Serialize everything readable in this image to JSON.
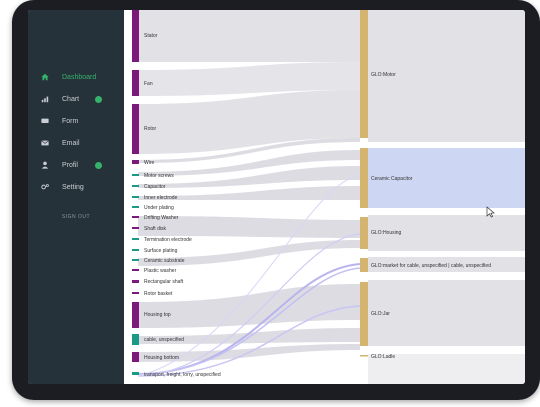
{
  "sidebar": {
    "items": [
      {
        "label": "Dashboard",
        "icon": "home-icon",
        "active": true
      },
      {
        "label": "Chart",
        "icon": "bar-chart-icon",
        "badge": true
      },
      {
        "label": "Form",
        "icon": "form-icon"
      },
      {
        "label": "Email",
        "icon": "email-icon"
      },
      {
        "label": "Profil",
        "icon": "user-icon",
        "badge": true
      },
      {
        "label": "Setting",
        "icon": "gear-icon"
      }
    ],
    "signout": "SIGN OUT",
    "accent": "#36b36a"
  },
  "sankey": {
    "left_nodes": [
      {
        "label": "Stator",
        "color": "#7b1a7a"
      },
      {
        "label": "Fan",
        "color": "#7b1a7a"
      },
      {
        "label": "Rotor",
        "color": "#7b1a7a"
      },
      {
        "label": "Wire",
        "color": "#7b1a7a"
      },
      {
        "label": "Motor screws",
        "color": "#1a9a86"
      },
      {
        "label": "Capacitor",
        "color": "#1a9a86"
      },
      {
        "label": "Inner electrode",
        "color": "#1a9a86"
      },
      {
        "label": "Under plating",
        "color": "#1a9a86"
      },
      {
        "label": "Drifting Washer",
        "color": "#7b1a7a"
      },
      {
        "label": "Shaft disk",
        "color": "#7b1a7a"
      },
      {
        "label": "Termination electrode",
        "color": "#1a9a86"
      },
      {
        "label": "Surface plating",
        "color": "#1a9a86"
      },
      {
        "label": "Ceramic substrate",
        "color": "#1a9a86"
      },
      {
        "label": "Plastic washer",
        "color": "#7b1a7a"
      },
      {
        "label": "Rectangular shaft",
        "color": "#7b1a7a"
      },
      {
        "label": "Rotor basket",
        "color": "#7b1a7a"
      },
      {
        "label": "Housing top",
        "color": "#7b1a7a"
      },
      {
        "label": "cable, unspecified",
        "color": "#1a9a86"
      },
      {
        "label": "Housing bottom",
        "color": "#7b1a7a"
      },
      {
        "label": "transport, freight, lorry, unspecified",
        "color": "#1a9a86"
      }
    ],
    "right_nodes": [
      {
        "label": "GLO:Motor",
        "color": "#d4b46e"
      },
      {
        "label": "Ceramic Capacitor",
        "color": "#d4b46e"
      },
      {
        "label": "GLO:Housing",
        "color": "#d4b46e"
      },
      {
        "label": "GLO:market for cable, unspecified | cable, unspecified",
        "color": "#d4b46e"
      },
      {
        "label": "GLO:Jar",
        "color": "#d4b46e"
      },
      {
        "label": "GLO:Ladle",
        "color": "#d4b46e"
      }
    ],
    "link_color": "#d4d4da",
    "highlight_color": "#c8d2f2",
    "purple_link_color": "#b9b4ee"
  }
}
